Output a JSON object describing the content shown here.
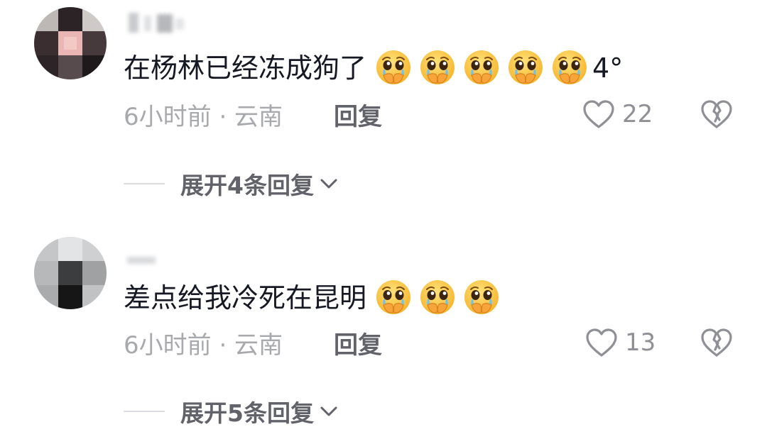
{
  "comments": [
    {
      "text": "在杨林已经冻成狗了",
      "emoji_count": 5,
      "emoji_icon": "pleading-face-covering-mouth-emoji",
      "suffix": "4°",
      "meta": "6小时前 · 云南",
      "reply_label": "回复",
      "likes": "22",
      "expand_label": "展开4条回复"
    },
    {
      "text": "差点给我冷死在昆明",
      "emoji_count": 3,
      "emoji_icon": "pleading-face-covering-mouth-emoji",
      "suffix": "",
      "meta": "6小时前 · 云南",
      "reply_label": "回复",
      "likes": "13",
      "expand_label": "展开5条回复"
    }
  ],
  "colors": {
    "text_primary": "#161823",
    "text_secondary": "#a8a9ad",
    "reply": "#61626a",
    "icon": "#8f9096"
  }
}
